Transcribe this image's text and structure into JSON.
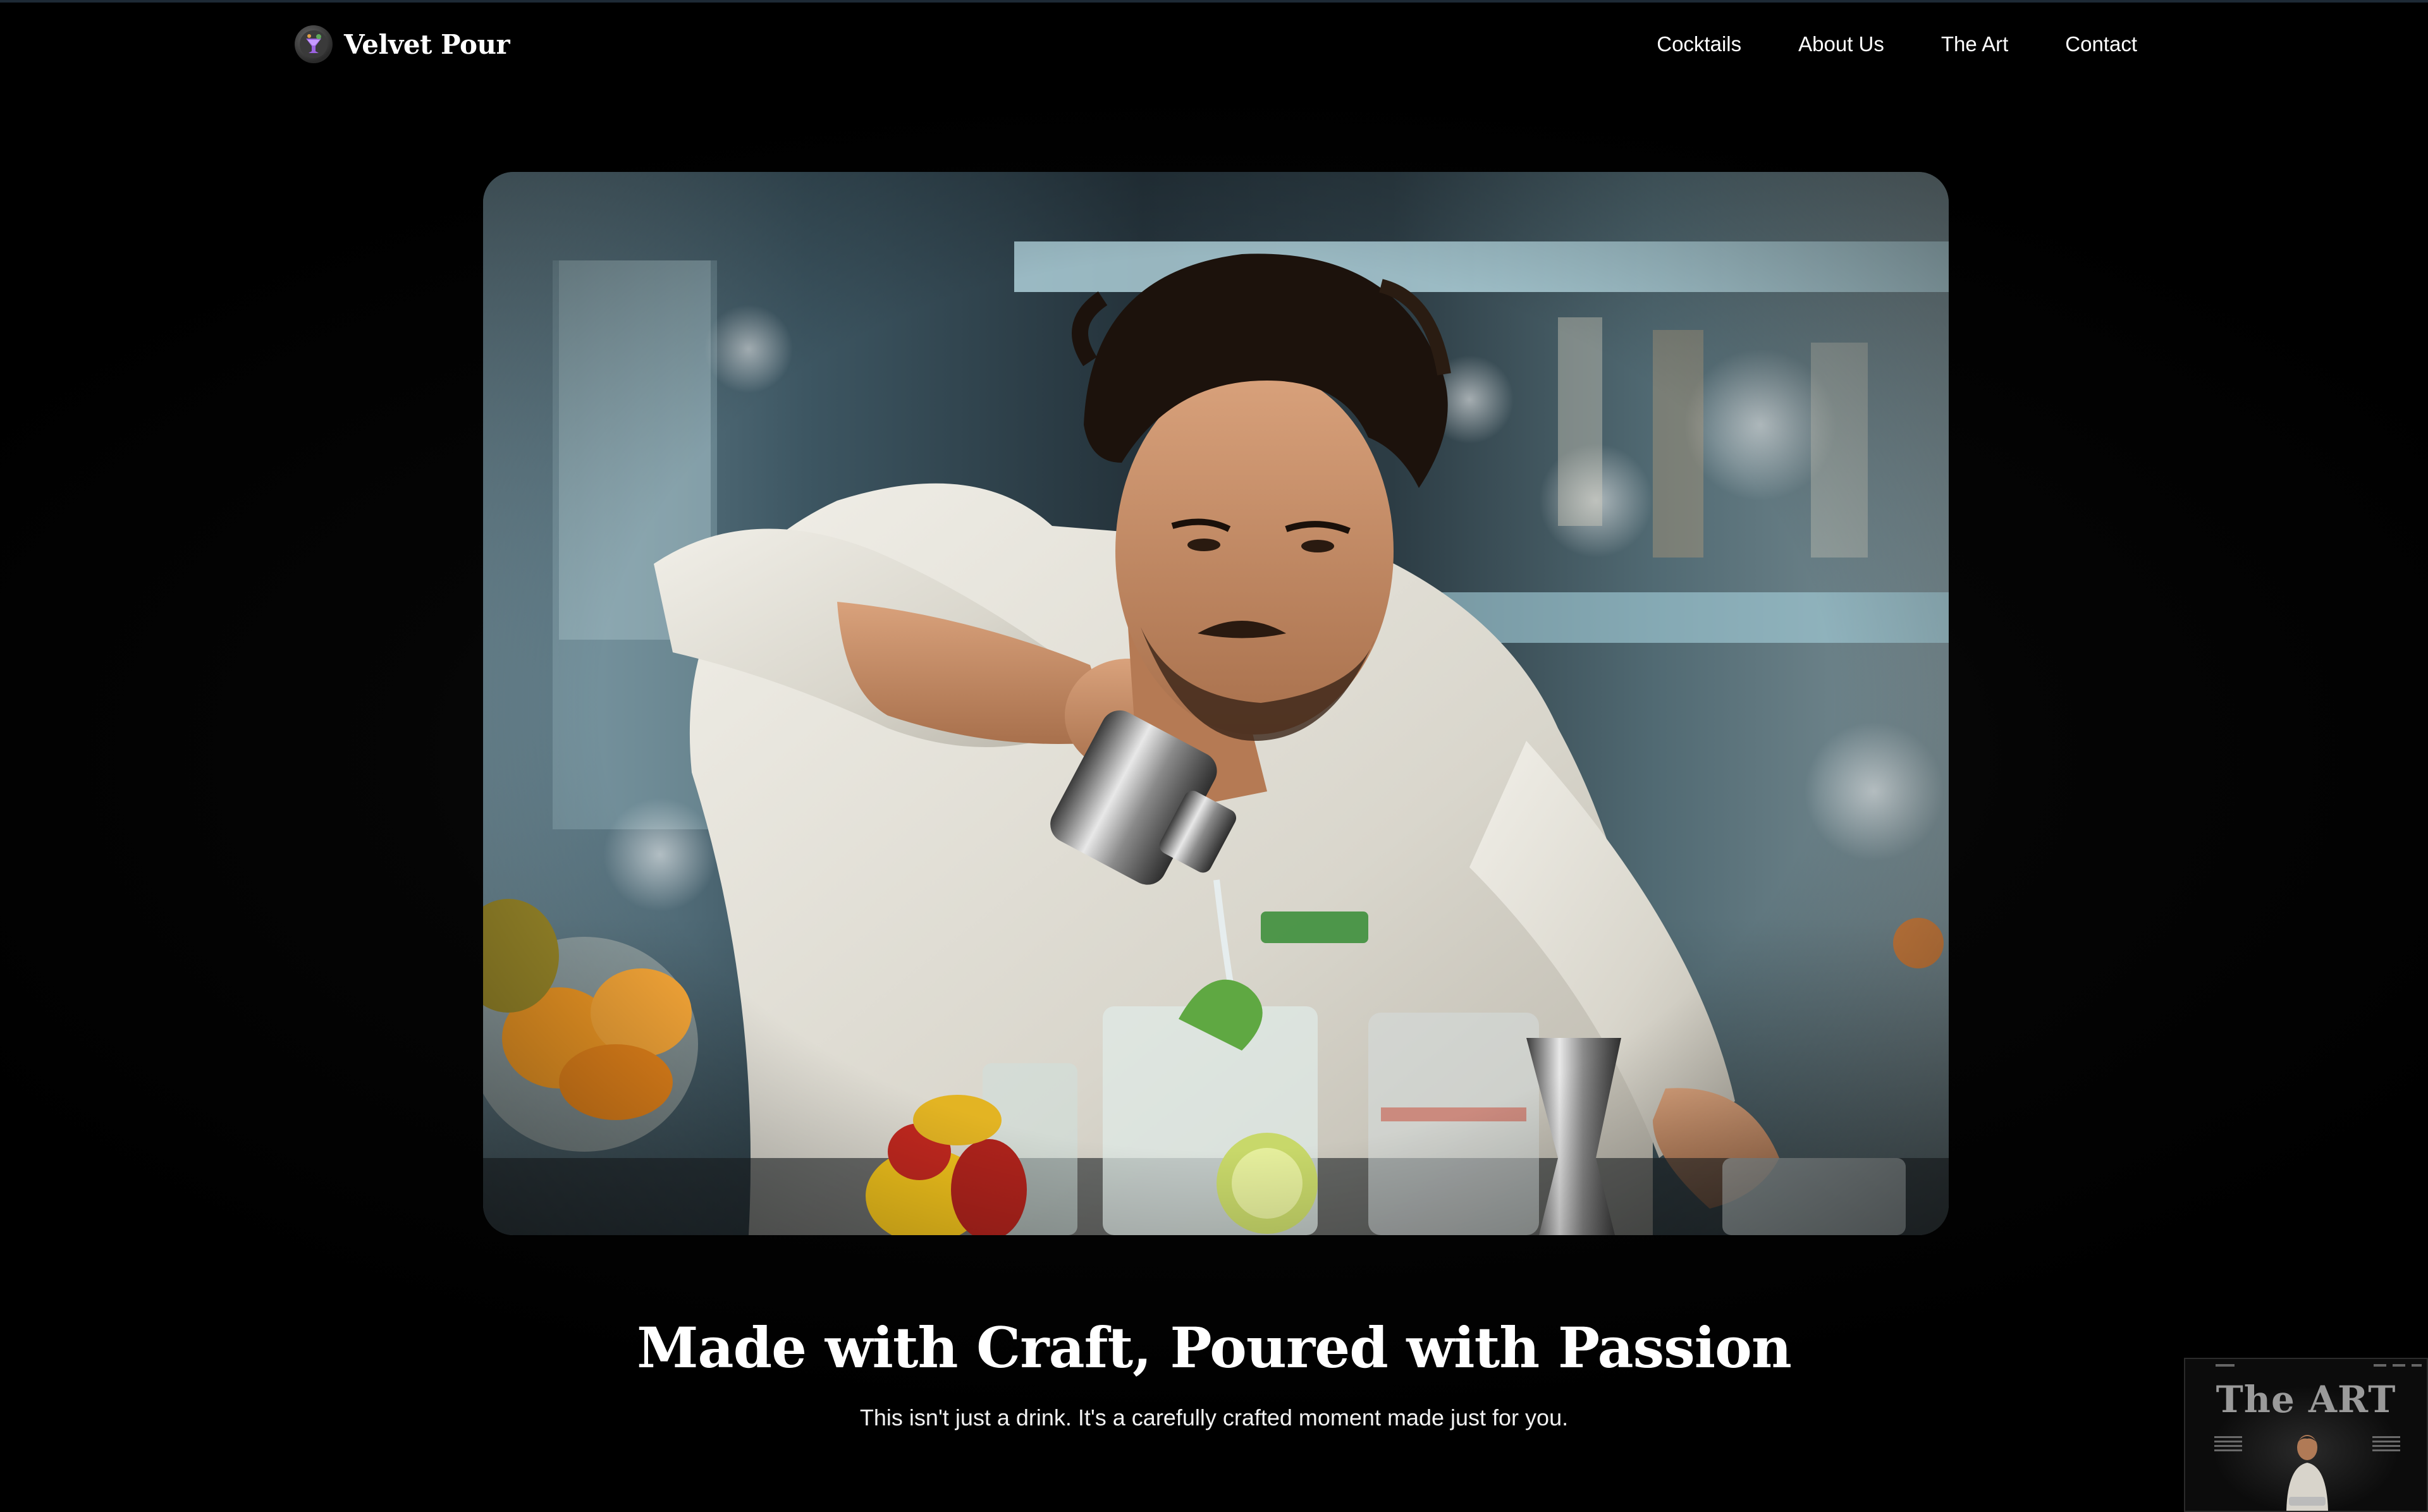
{
  "brand": {
    "name": "Velvet Pour",
    "logo_icon": "cocktail-glass-icon"
  },
  "nav": {
    "items": [
      {
        "label": "Cocktails"
      },
      {
        "label": "About Us"
      },
      {
        "label": "The Art"
      },
      {
        "label": "Contact"
      }
    ]
  },
  "hero": {
    "image": "bartender-pouring-cocktail-photo"
  },
  "headline": "Made with Craft, Poured with Passion",
  "subhead": "This isn't just a drink. It's a carefully crafted moment made just for you.",
  "thumbnail": {
    "title": "The ART"
  },
  "colors": {
    "background": "#000000",
    "text": "#ffffff",
    "accent_logo": "#8e5bd6"
  }
}
